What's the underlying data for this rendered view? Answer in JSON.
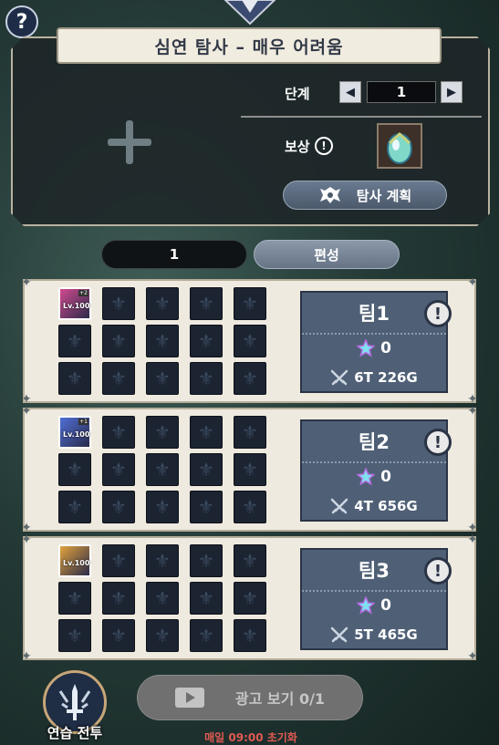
{
  "help": {
    "label": "?"
  },
  "header": {
    "title": "심연 탐사 – 매우 어려움",
    "stage_label": "단계",
    "stage_value": "1",
    "reward_label": "보상",
    "plan_button_label": "탐사 계획"
  },
  "formation": {
    "value": "1",
    "edit_label": "편성"
  },
  "teams": [
    {
      "name": "팀1",
      "stars": "0",
      "power": "6T 226G",
      "leader_level": "Lv.100",
      "leader_badge": "+2"
    },
    {
      "name": "팀2",
      "stars": "0",
      "power": "4T 656G",
      "leader_level": "Lv.100",
      "leader_badge": "+1"
    },
    {
      "name": "팀3",
      "stars": "0",
      "power": "5T 465G",
      "leader_level": "Lv.100",
      "leader_badge": ""
    }
  ],
  "bottom": {
    "practice_label": "연습 전투",
    "ad_label": "광고 보기 0/1",
    "reset_text": "매일 09:00 초기화"
  },
  "colors": {
    "accent_red": "#e05a52",
    "panel_cream": "#efeadf",
    "card_slate": "#4f6076"
  }
}
